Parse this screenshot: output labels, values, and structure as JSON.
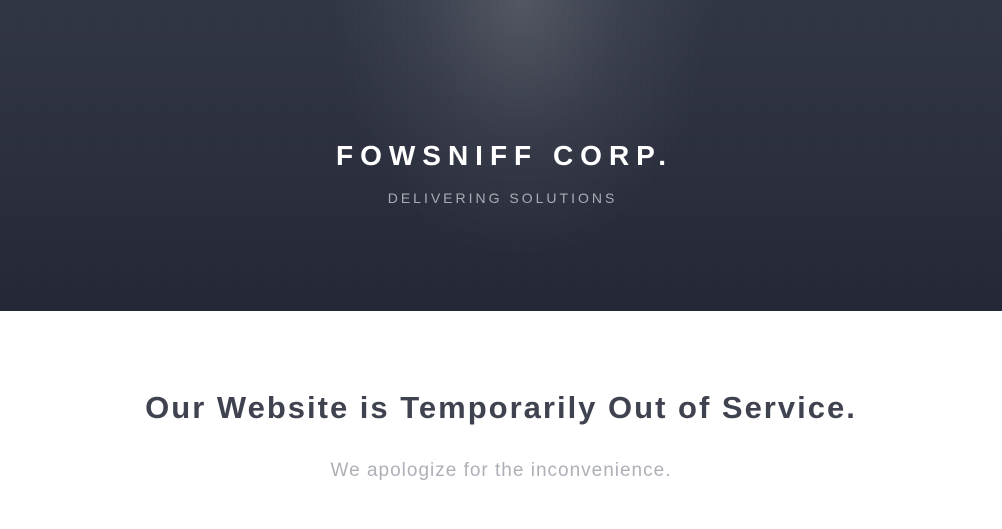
{
  "hero": {
    "title": "FOWSNIFF CORP.",
    "tagline": "DELIVERING SOLUTIONS"
  },
  "main": {
    "heading": "Our Website is Temporarily Out of Service.",
    "message": "We apologize for the inconvenience."
  },
  "colors": {
    "hero_background": "#2a2e3d",
    "heading_text": "#3f4350",
    "muted_text": "#aeb0b8",
    "page_background": "#ffffff"
  }
}
